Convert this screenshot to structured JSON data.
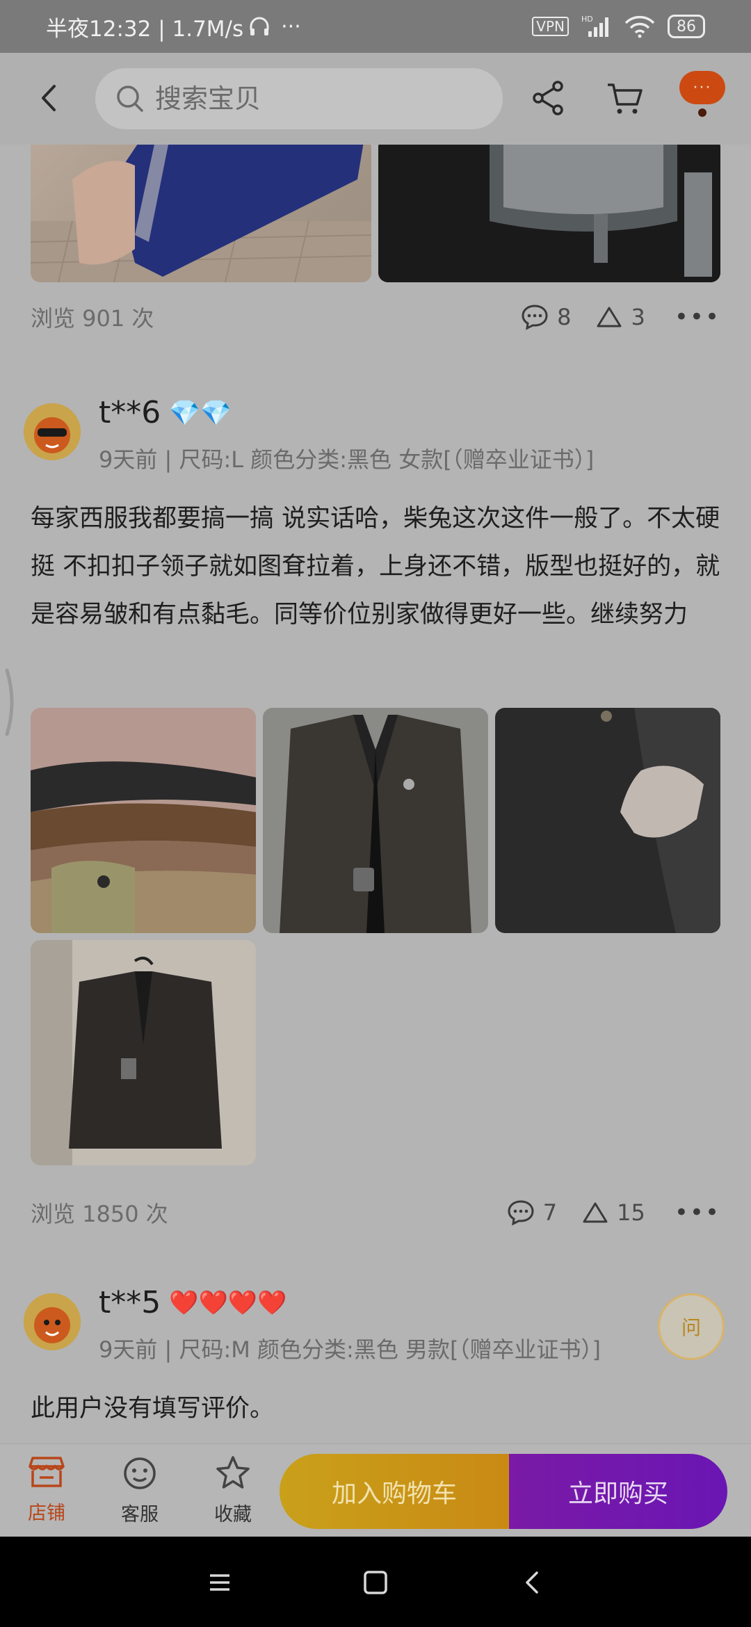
{
  "status_bar": {
    "time_speed": "半夜12:32 | 1.7M/s",
    "more": "···",
    "vpn": "VPN",
    "hd": "HD",
    "battery": "86"
  },
  "header": {
    "search_placeholder": "搜索宝贝",
    "more_label": "···"
  },
  "reviews": [
    {
      "views": "浏览 901 次",
      "comments": "8",
      "likes": "3"
    },
    {
      "username": "t**6",
      "badge": "💎💎",
      "meta": "9天前 | 尺码:L 颜色分类:黑色 女款[（赠卒业证书）]",
      "text": "每家西服我都要搞一搞 说实话哈，柴兔这次这件一般了。不太硬挺 不扣扣子领子就如图耷拉着，上身还不错，版型也挺好的，就是容易皱和有点黏毛。同等价位别家做得更好一些。继续努力",
      "views": "浏览 1850 次",
      "comments": "7",
      "likes": "15"
    },
    {
      "username": "t**5",
      "badge": "❤️❤️❤️❤️",
      "meta": "9天前 | 尺码:M 颜色分类:黑色 男款[（赠卒业证书）]",
      "text": "此用户没有填写评价。"
    }
  ],
  "ask_label": "问",
  "bottom_bar": {
    "store": "店铺",
    "service": "客服",
    "favorite": "收藏",
    "add_to_cart": "加入购物车",
    "buy_now": "立即购买"
  },
  "colors": {
    "accent_orange": "#cc4a12",
    "cart_button": "#c9a01a",
    "buy_button": "#7a1aa6"
  }
}
